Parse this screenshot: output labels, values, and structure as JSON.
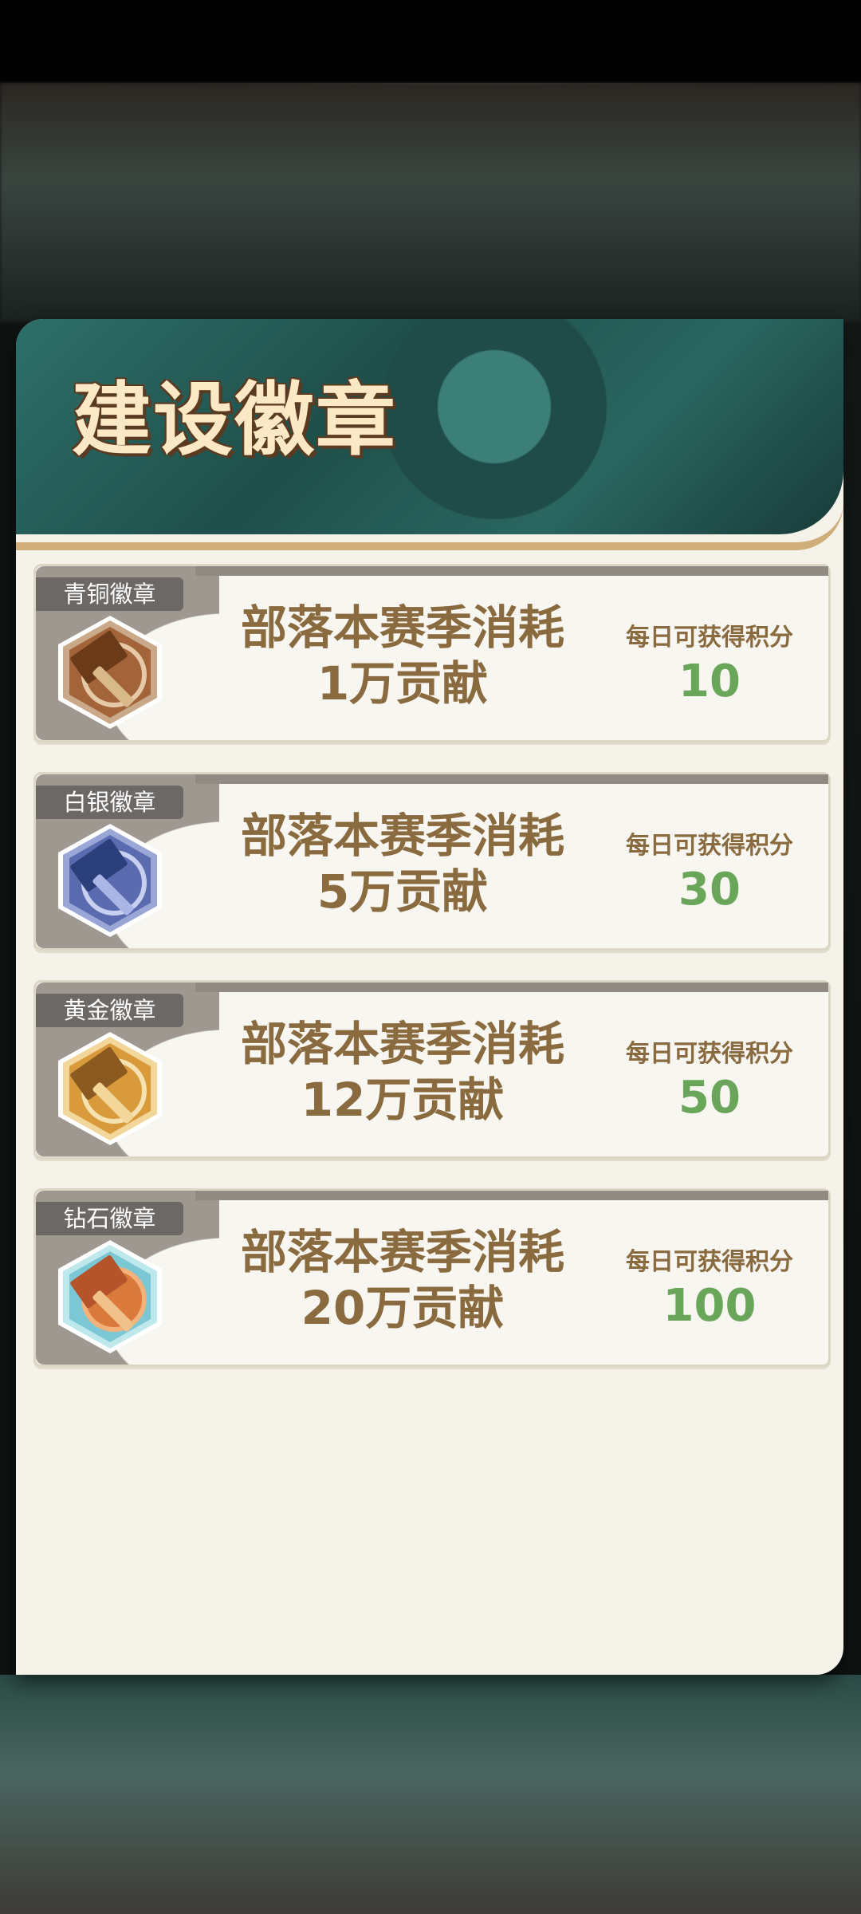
{
  "panel": {
    "title": "建设徽章"
  },
  "badges": [
    {
      "tier": "青铜徽章",
      "req_line1": "部落本赛季消耗",
      "req_line2": "1万贡献",
      "points_label": "每日可获得积分",
      "points": "10",
      "colors": {
        "hex_outer": "#c9a98a",
        "hex_inner": "#a3643a",
        "hammer": "#6b3a18"
      }
    },
    {
      "tier": "白银徽章",
      "req_line1": "部落本赛季消耗",
      "req_line2": "5万贡献",
      "points_label": "每日可获得积分",
      "points": "30",
      "colors": {
        "hex_outer": "#9aa6d6",
        "hex_inner": "#5a6bb0",
        "hammer": "#2b3f7a"
      }
    },
    {
      "tier": "黄金徽章",
      "req_line1": "部落本赛季消耗",
      "req_line2": "12万贡献",
      "points_label": "每日可获得积分",
      "points": "50",
      "colors": {
        "hex_outer": "#f2d69a",
        "hex_inner": "#d99a3c",
        "hammer": "#8a5a20"
      }
    },
    {
      "tier": "钻石徽章",
      "req_line1": "部落本赛季消耗",
      "req_line2": "20万贡献",
      "points_label": "每日可获得积分",
      "points": "100",
      "colors": {
        "hex_outer": "#bfe8ec",
        "hex_inner": "#7cc7d4",
        "hammer": "#b5532a"
      }
    }
  ]
}
